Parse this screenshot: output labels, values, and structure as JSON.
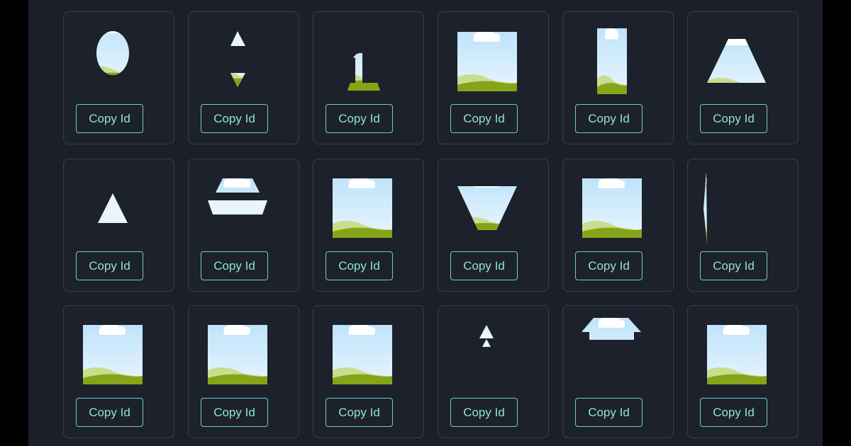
{
  "theme": {
    "background": "#1a1f2a",
    "card_background": "#1c212c",
    "card_border": "#3a404b",
    "accent": "#6fd2c0",
    "sky_top": "#bfe3fb",
    "sky_bottom": "#e8f5fd",
    "hill_light": "#c8dd8e",
    "hill_dark": "#86a418",
    "cloud": "#ffffff"
  },
  "cards": [
    {
      "icon": "oval-landscape-icon",
      "button_label": "Copy Id"
    },
    {
      "icon": "triangles-up-down-icon",
      "button_label": "Copy Id"
    },
    {
      "icon": "number-one-landscape-icon",
      "button_label": "Copy Id"
    },
    {
      "icon": "square-landscape-icon",
      "button_label": "Copy Id"
    },
    {
      "icon": "tall-rectangle-landscape-icon",
      "button_label": "Copy Id"
    },
    {
      "icon": "trapezoid-landscape-icon",
      "button_label": "Copy Id"
    },
    {
      "icon": "triangle-icon",
      "button_label": "Copy Id"
    },
    {
      "icon": "trapezoid-stack-icon",
      "button_label": "Copy Id"
    },
    {
      "icon": "square-landscape-icon",
      "button_label": "Copy Id"
    },
    {
      "icon": "inverted-trapezoid-landscape-icon",
      "button_label": "Copy Id"
    },
    {
      "icon": "square-landscape-icon",
      "button_label": "Copy Id"
    },
    {
      "icon": "thin-sliver-landscape-icon",
      "button_label": "Copy Id"
    },
    {
      "icon": "square-landscape-icon",
      "button_label": "Copy Id"
    },
    {
      "icon": "square-landscape-icon",
      "button_label": "Copy Id"
    },
    {
      "icon": "square-landscape-icon",
      "button_label": "Copy Id"
    },
    {
      "icon": "small-tree-icon",
      "button_label": "Copy Id"
    },
    {
      "icon": "house-roof-landscape-icon",
      "button_label": "Copy Id"
    },
    {
      "icon": "square-landscape-icon",
      "button_label": "Copy Id"
    }
  ]
}
